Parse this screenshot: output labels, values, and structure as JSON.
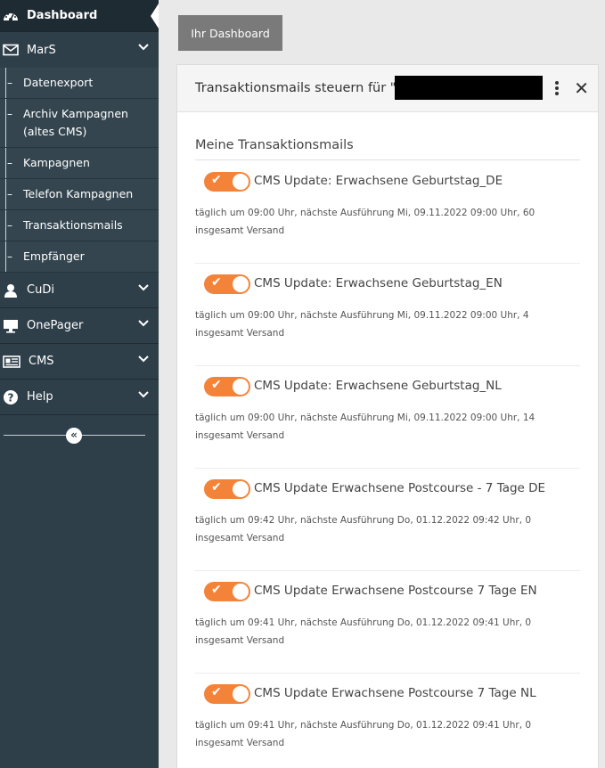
{
  "sidebar": {
    "dashboard_label": "Dashboard",
    "mars_label": "MarS",
    "submenu": [
      "Datenexport",
      "Archiv Kampagnen (altes CMS)",
      "Kampagnen",
      "Telefon Kampagnen",
      "Transaktionsmails",
      "Empfänger"
    ],
    "cudi_label": "CuDi",
    "onepager_label": "OnePager",
    "cms_label": "CMS",
    "help_label": "Help",
    "collapse_glyph": "«",
    "icons": [
      "dashboard-icon",
      "envelope-icon",
      "user-icon",
      "monitor-icon",
      "newspaper-icon",
      "help-circle-icon"
    ]
  },
  "main": {
    "tab_label": "Ihr Dashboard",
    "panel_title": "Transaktionsmails steuern für \"h",
    "section_title": "Meine Transaktionsmails",
    "accent": "#f4833a",
    "items": [
      {
        "name": "CMS Update: Erwachsene Geburtstag_DE",
        "desc": "täglich um 09:00 Uhr, nächste Ausführung Mi, 09.11.2022 09:00 Uhr, 60 insgesamt Versand",
        "enabled": true
      },
      {
        "name": "CMS Update: Erwachsene Geburtstag_EN",
        "desc": "täglich um 09:00 Uhr, nächste Ausführung Mi, 09.11.2022 09:00 Uhr, 4 insgesamt Versand",
        "enabled": true
      },
      {
        "name": "CMS Update: Erwachsene Geburtstag_NL",
        "desc": "täglich um 09:00 Uhr, nächste Ausführung Mi, 09.11.2022 09:00 Uhr, 14 insgesamt Versand",
        "enabled": true
      },
      {
        "name": "CMS Update Erwachsene Postcourse - 7 Tage DE",
        "desc": "täglich um 09:42 Uhr, nächste Ausführung Do, 01.12.2022 09:42 Uhr, 0 insgesamt Versand",
        "enabled": true
      },
      {
        "name": "CMS Update Erwachsene Postcourse 7 Tage EN",
        "desc": "täglich um 09:41 Uhr, nächste Ausführung Do, 01.12.2022 09:41 Uhr, 0 insgesamt Versand",
        "enabled": true
      },
      {
        "name": "CMS Update Erwachsene Postcourse 7 Tage NL",
        "desc": "täglich um 09:41 Uhr, nächste Ausführung Do, 01.12.2022 09:41 Uhr, 0 insgesamt Versand",
        "enabled": true
      }
    ]
  }
}
